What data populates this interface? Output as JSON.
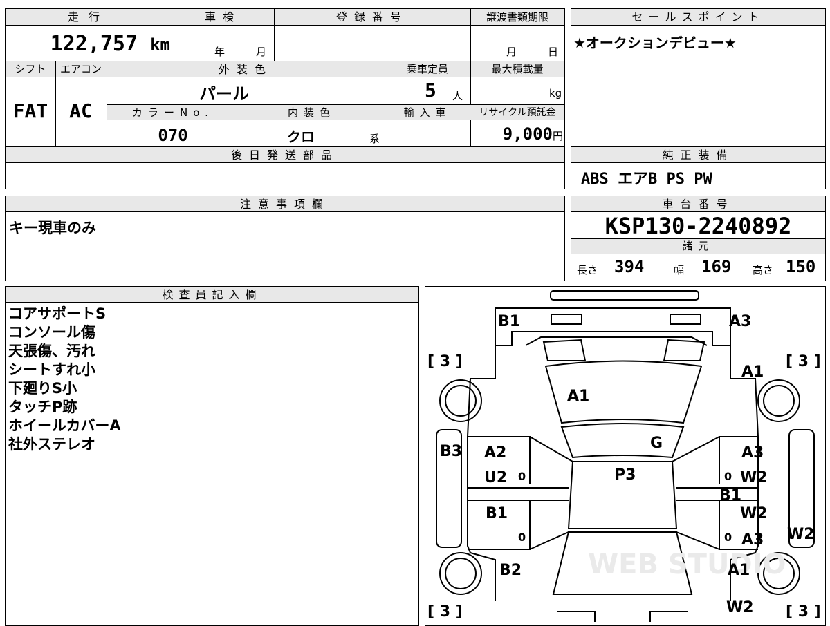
{
  "top_grid": {
    "mileage_label": "走行",
    "mileage_value": "122,757",
    "mileage_unit": "km",
    "inspection_label": "車検",
    "inspection_year": "年",
    "inspection_month": "月",
    "registration_label": "登録番号",
    "registration_value": "",
    "transfer_deadline_label": "譲渡書類期限",
    "transfer_month": "月",
    "transfer_day": "日",
    "shift_label": "シフト",
    "shift_value": "FAT",
    "ac_label": "エアコン",
    "ac_value": "AC",
    "exterior_color_label": "外装色",
    "exterior_color_value": "パール",
    "capacity_label": "乗車定員",
    "capacity_value": "5",
    "capacity_unit": "人",
    "max_load_label": "最大積載量",
    "max_load_unit": "kg",
    "color_no_label": "カラーNo.",
    "color_no_value": "070",
    "interior_color_label": "内装色",
    "interior_color_value": "クロ",
    "interior_color_suffix": "系",
    "import_label": "輸入車",
    "recycle_label": "リサイクル預託金",
    "recycle_value": "9,000",
    "recycle_unit": "円",
    "later_parts_label": "後日発送部品"
  },
  "sales_point": {
    "label": "セールスポイント",
    "text": "★オークションデビュー★"
  },
  "equipment": {
    "label": "純正装備",
    "text": "ABS エアB PS PW"
  },
  "notes": {
    "label": "注意事項欄",
    "text": "キー現車のみ"
  },
  "chassis": {
    "label": "車台番号",
    "value": "KSP130-2240892",
    "specs_label": "諸元",
    "length_label": "長さ",
    "length_value": "394",
    "width_label": "幅",
    "width_value": "169",
    "height_label": "高さ",
    "height_value": "150"
  },
  "inspector": {
    "label": "検査員記入欄",
    "lines": [
      "コアサポートS",
      "コンソール傷",
      "天張傷、汚れ",
      "シートすれ小",
      "下廻りS小",
      "タッチP跡",
      "ホイールカバーA",
      "社外ステレオ"
    ]
  },
  "diagram": {
    "tire_tl": "[ 3 ]",
    "tire_tr": "[ 3 ]",
    "tire_bl": "[ 3 ]",
    "tire_br": "[ 3 ]",
    "marks": {
      "front_left_corner": "B1",
      "front_right_corner": "A3",
      "right_front_fender": "A1",
      "hood": "A1",
      "windshield": "G",
      "roof": "P3",
      "left_side_panel": "B3",
      "left_front_door_1": "A2",
      "left_front_door_2": "U2",
      "left_rear_door": "B1",
      "left_rear_fender": "B2",
      "right_front_door_1": "A3",
      "right_front_door_2": "W2",
      "right_center": "B1",
      "right_rear_door_1": "W2",
      "right_rear_door_2": "A3",
      "right_side_panel": "W2",
      "right_rear_fender": "A1",
      "right_rear_bottom": "W2"
    },
    "pillar_marks": [
      "0",
      "0",
      "0",
      "0"
    ],
    "watermark": "WEB STUDIO"
  }
}
